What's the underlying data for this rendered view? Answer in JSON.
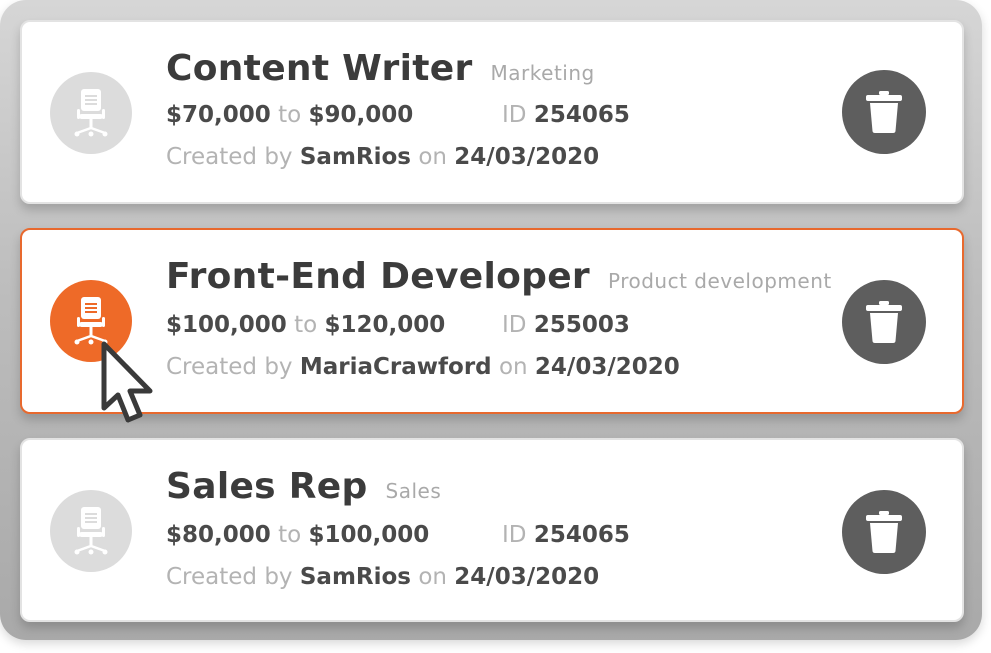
{
  "jobs": [
    {
      "title": "Content Writer",
      "department": "Marketing",
      "salary_min": "$70,000",
      "to": "to",
      "salary_max": "$90,000",
      "id_label": "ID",
      "id_value": "254065",
      "created_by_label": "Created by",
      "author": "SamRios",
      "on_label": "on",
      "date": "24/03/2020",
      "selected": false
    },
    {
      "title": "Front-End Developer",
      "department": "Product development",
      "salary_min": "$100,000",
      "to": "to",
      "salary_max": "$120,000",
      "id_label": "ID",
      "id_value": "255003",
      "created_by_label": "Created by",
      "author": "MariaCrawford",
      "on_label": "on",
      "date": "24/03/2020",
      "selected": true
    },
    {
      "title": "Sales Rep",
      "department": "Sales",
      "salary_min": "$80,000",
      "to": "to",
      "salary_max": "$100,000",
      "id_label": "ID",
      "id_value": "254065",
      "created_by_label": "Created by",
      "author": "SamRios",
      "on_label": "on",
      "date": "24/03/2020",
      "selected": false
    }
  ],
  "icons": {
    "job": "office-chair-icon",
    "delete": "trash-icon",
    "cursor": "mouse-pointer-icon"
  },
  "colors": {
    "accent": "#ee6a28",
    "selected_border": "#e8692e",
    "avatar_inactive": "#dcdcdc",
    "trash_bg": "#5e5e5e",
    "title_text": "#3b3b3b",
    "muted_text": "#b3b3b3"
  }
}
